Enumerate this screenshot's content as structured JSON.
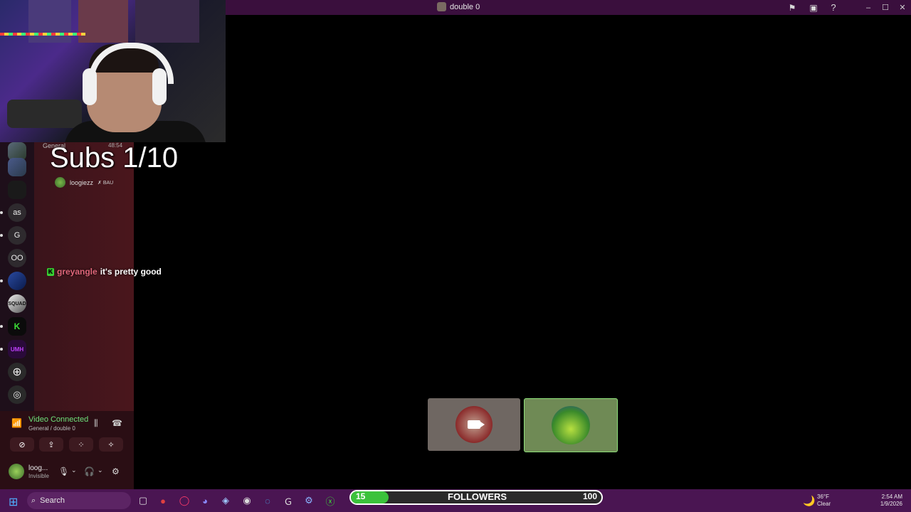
{
  "window": {
    "title": "double 0"
  },
  "overlay": {
    "subs": "Subs 1/10"
  },
  "voice_channel": {
    "name": "General",
    "time": "48:54",
    "user": "loogiezz",
    "user_badge": "✗ BAU"
  },
  "chat": {
    "username": "greyangle",
    "message": "it's pretty good"
  },
  "servers": [
    {
      "label": "as"
    },
    {
      "label": "G"
    },
    {
      "label": "OO"
    },
    {
      "label": "SQUAD"
    },
    {
      "label": "UMH"
    }
  ],
  "voice_panel": {
    "status": "Video Connected",
    "channel": "General / double 0",
    "user_name": "loog...",
    "user_status": "Invisible"
  },
  "taskbar": {
    "search_placeholder": "Search",
    "followers_label": "FOLLOWERS",
    "followers_current": "15",
    "followers_goal": "100",
    "followers_fraction": 0.15,
    "temperature": "36°F",
    "weather": "Clear",
    "time": "2:54 AM",
    "date": "1/9/2026"
  },
  "colors": {
    "titlebar": "#3a0f3d",
    "taskbar": "#4a1552",
    "connected_green": "#6ee07a",
    "chat_name": "#e0667a"
  }
}
